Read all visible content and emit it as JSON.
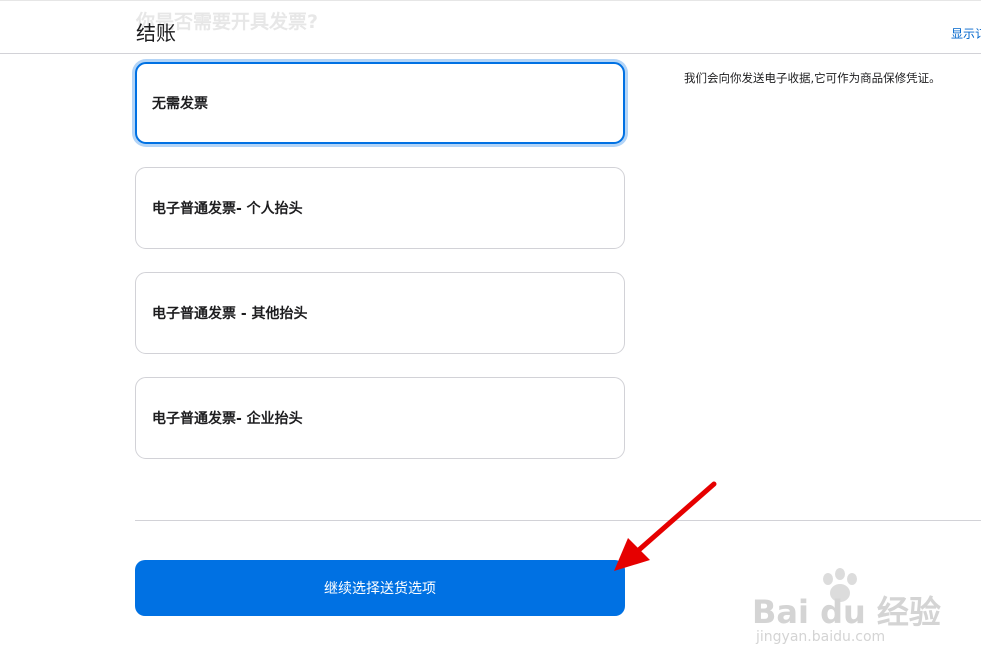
{
  "header": {
    "ghost_heading": "你是否需要开具发票?",
    "title": "结账",
    "show_summary_label": "显示订"
  },
  "note": "我们会向你发送电子收据,它可作为商品保修凭证。",
  "invoice_options": [
    {
      "label": "无需发票",
      "selected": true
    },
    {
      "label": "电子普通发票- 个人抬头",
      "selected": false
    },
    {
      "label": "电子普通发票 - 其他抬头",
      "selected": false
    },
    {
      "label": "电子普通发票- 企业抬头",
      "selected": false
    }
  ],
  "continue_button_label": "继续选择送货选项",
  "watermark": {
    "text": "Bai du 经验",
    "subtext": "jingyan.baidu.com"
  },
  "colors": {
    "accent": "#0071e3",
    "link": "#0066cc",
    "annotation_arrow": "#e60000",
    "border": "#d2d2d7"
  }
}
